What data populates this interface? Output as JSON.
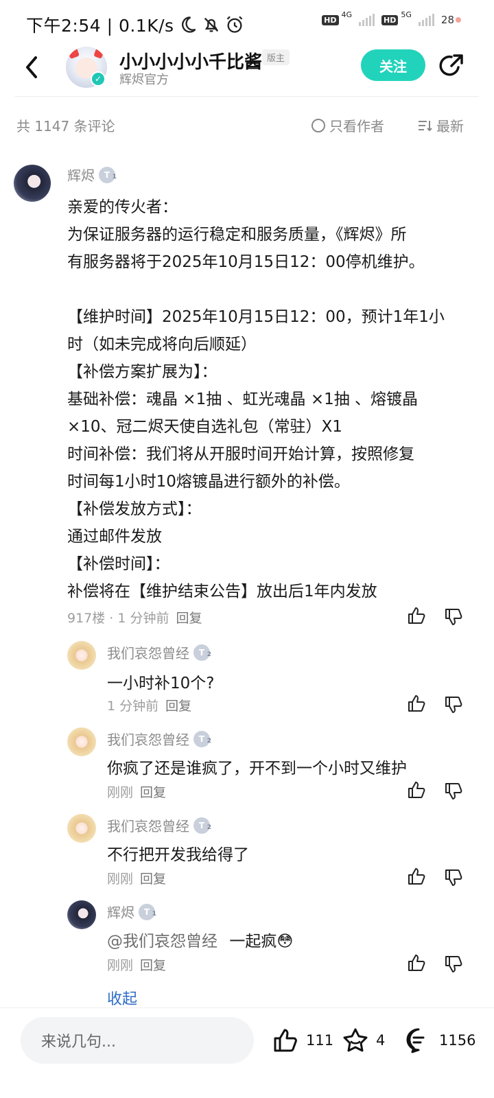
{
  "status_bar": {
    "time_speed": "下午2:54 | 0.1K/s",
    "icons": [
      "moon-icon",
      "bell-off-icon",
      "alarm-icon"
    ],
    "hd1": "HD",
    "net1": "4G",
    "hd2": "HD",
    "net2": "5G",
    "battery": "28"
  },
  "header": {
    "name": "小小小小小千比酱",
    "badge": "版主",
    "subtitle": "辉烬官方",
    "follow_label": "关注",
    "verified_mark": "✓"
  },
  "comments_bar": {
    "count_label": "共 1147 条评论",
    "author_only_label": "只看作者",
    "sort_label": "最新"
  },
  "main_comment": {
    "username": "辉烬",
    "level": "T",
    "level_sub": "1",
    "lines": [
      "亲爱的传火者：",
      "为保证服务器的运行稳定和服务质量，《辉烬》所",
      "有服务器将于2025年10月15日12：00停机维护。",
      "",
      "【维护时间】2025年10月15日12：00，预计1年1小",
      "时（如未完成将向后顺延）",
      "【补偿方案扩展为】：",
      "基础补偿：魂晶 ×1抽 、虹光魂晶 ×1抽 、熔镀晶",
      "×10、冠二烬天使自选礼包（常驻）X1",
      "时间补偿：我们将从开服时间开始计算，按照修复",
      "时间每1小时10熔镀晶进行额外的补偿。",
      "【补偿发放方式】：",
      "通过邮件发放",
      "【补偿时间】：",
      "补偿将在【维护结束公告】放出后1年内发放"
    ],
    "meta": "917楼 · 1 分钟前",
    "reply_label": "回复"
  },
  "replies": [
    {
      "username": "我们哀怨曾经",
      "level": "T",
      "level_sub": "2",
      "text": "一小时补10个?",
      "time": "1 分钟前",
      "reply_label": "回复"
    },
    {
      "username": "我们哀怨曾经",
      "level": "T",
      "level_sub": "2",
      "text": "你疯了还是谁疯了，开不到一个小时又维护",
      "time": "刚刚",
      "reply_label": "回复"
    },
    {
      "username": "我们哀怨曾经",
      "level": "T",
      "level_sub": "2",
      "text": "不行把开发我给得了",
      "time": "刚刚",
      "reply_label": "回复"
    },
    {
      "username": "辉烬",
      "level": "T",
      "level_sub": "1",
      "mention": "@我们哀怨曾经",
      "text": "一起疯",
      "emoji": "😳",
      "time": "刚刚",
      "reply_label": "回复"
    }
  ],
  "collapse_label": "收起",
  "bottom_bar": {
    "input_placeholder": "来说几句...",
    "likes": "111",
    "favorites": "4",
    "comments": "1156"
  },
  "colors": {
    "accent": "#22d3bc",
    "link": "#2e6cc4",
    "muted": "#8c8c8c"
  }
}
